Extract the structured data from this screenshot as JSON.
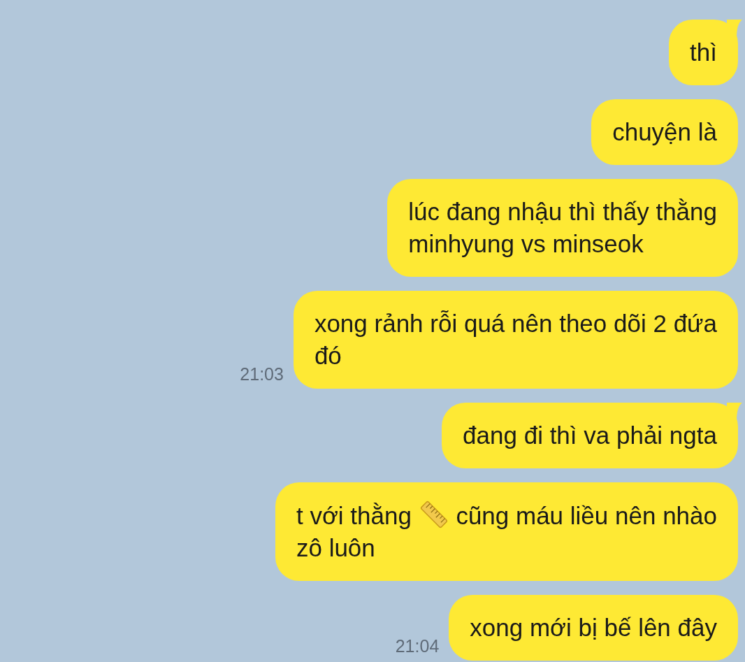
{
  "messages": [
    {
      "tail": true,
      "parts": [
        {
          "kind": "text",
          "text": "thì"
        }
      ]
    },
    {
      "tail": false,
      "parts": [
        {
          "kind": "text",
          "text": "chuyện là"
        }
      ]
    },
    {
      "tail": false,
      "parts": [
        {
          "kind": "text",
          "text": "lúc đang nhậu thì thấy thằng\nminhyung vs minseok"
        }
      ]
    },
    {
      "tail": false,
      "time": "21:03",
      "parts": [
        {
          "kind": "text",
          "text": "xong rảnh rỗi quá nên theo dõi 2 đứa\nđó"
        }
      ]
    },
    {
      "tail": true,
      "parts": [
        {
          "kind": "text",
          "text": "đang đi thì va phải ngta"
        }
      ]
    },
    {
      "tail": false,
      "parts": [
        {
          "kind": "text",
          "text": "t với thằng "
        },
        {
          "kind": "ruler"
        },
        {
          "kind": "text",
          "text": " cũng máu liều nên nhào\nzô luôn"
        }
      ]
    },
    {
      "tail": false,
      "time": "21:04",
      "parts": [
        {
          "kind": "text",
          "text": "xong mới bị bế lên đây"
        }
      ]
    }
  ]
}
